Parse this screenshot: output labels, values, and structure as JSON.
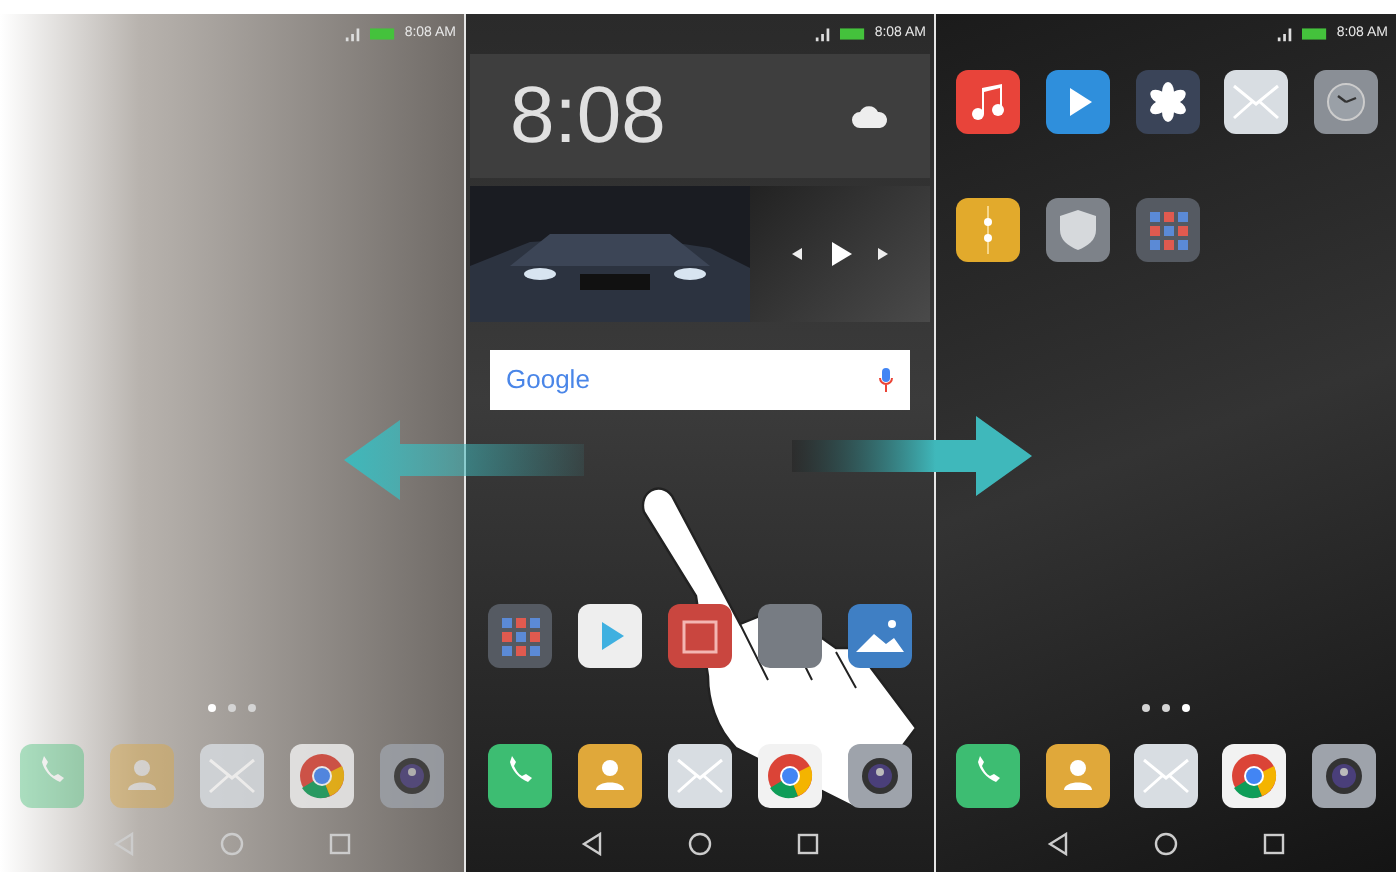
{
  "screens": [
    {
      "kind": "left",
      "status_time": "8:08 AM",
      "page_dots": [
        {
          "selected": true
        },
        {
          "selected": false
        },
        {
          "selected": false
        }
      ],
      "dock": [
        {
          "kind": "phone"
        },
        {
          "kind": "contacts"
        },
        {
          "kind": "email"
        },
        {
          "kind": "browser"
        },
        {
          "kind": "camera"
        }
      ]
    },
    {
      "kind": "center",
      "status_time": "8:08 AM",
      "clock": "8:08",
      "search_logo": "Google",
      "apps": [
        {
          "kind": "folder"
        },
        {
          "kind": "store"
        },
        {
          "kind": "calendar"
        },
        {
          "kind": "blank"
        },
        {
          "kind": "gallery"
        }
      ],
      "dock": [
        {
          "kind": "phone"
        },
        {
          "kind": "contacts"
        },
        {
          "kind": "email"
        },
        {
          "kind": "browser"
        },
        {
          "kind": "camera"
        }
      ]
    },
    {
      "kind": "right",
      "status_time": "8:08 AM",
      "apps": [
        {
          "kind": "music"
        },
        {
          "kind": "video"
        },
        {
          "kind": "themes"
        },
        {
          "kind": "email"
        },
        {
          "kind": "clock"
        },
        {
          "kind": "files"
        },
        {
          "kind": "shield"
        },
        {
          "kind": "folder"
        }
      ],
      "page_dots": [
        {
          "selected": false
        },
        {
          "selected": false
        },
        {
          "selected": true
        }
      ],
      "dock": [
        {
          "kind": "phone"
        },
        {
          "kind": "contacts"
        },
        {
          "kind": "email"
        },
        {
          "kind": "browser"
        },
        {
          "kind": "camera"
        }
      ]
    }
  ]
}
